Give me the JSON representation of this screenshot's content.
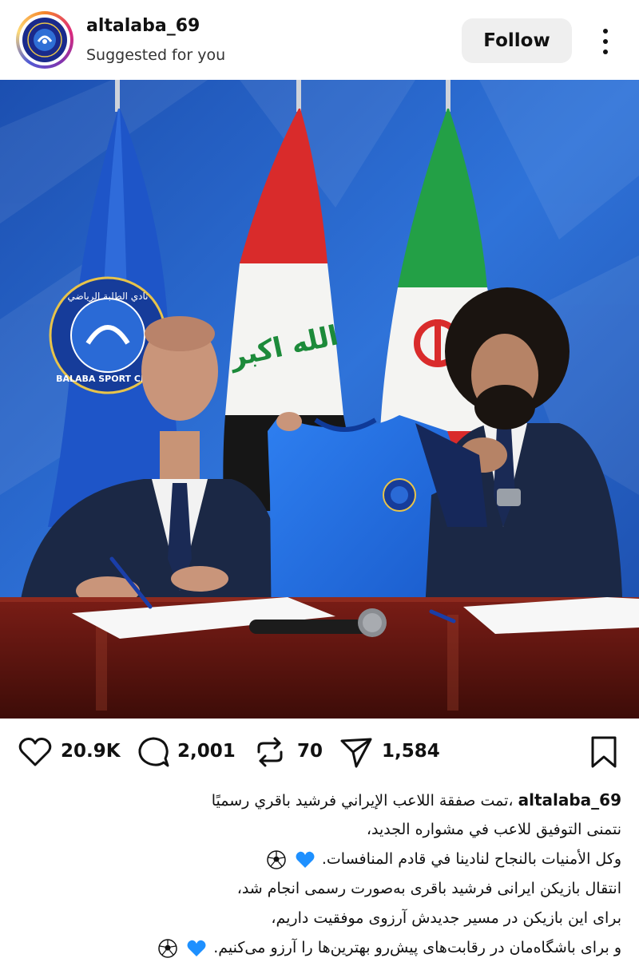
{
  "post": {
    "username": "altalaba_69",
    "subtitle": "Suggested for you",
    "follow_label": "Follow"
  },
  "actions": {
    "likes": "20.9K",
    "comments": "2,001",
    "reposts": "70",
    "shares": "1,584"
  },
  "caption": {
    "username": "altalaba_69",
    "lines": [
      "،تمت صفقة اللاعب الإيراني فرشيد باقري رسميًا",
      "نتمنى التوفيق للاعب في مشواره الجديد،",
      "وكل الأمنيات بالنجاح لنادينا في قادم المنافسات.",
      "انتقال بازیکن ایرانی فرشید باقری به‌صورت رسمی انجام شد،",
      "برای این بازیکن در مسیر جدیدش آرزوی موفقیت داریم،",
      "و برای باشگاه‌مان در رقابت‌های پیش‌رو بهترین‌ها را آرزو می‌کنیم."
    ]
  },
  "photo": {
    "club_flag_text": "BALABA SPORT CLUB",
    "club_flag_arabic": "نادي الطلبة الرياضي",
    "iraq_flag_text": "الله اكبر"
  },
  "colors": {
    "accent_blue": "#1d6fe0",
    "backdrop_blue": "#1e5fc4",
    "heart_blue": "#1e90ff"
  },
  "icons": [
    "heart-icon",
    "comment-icon",
    "repost-icon",
    "share-icon",
    "bookmark-icon",
    "more-icon",
    "soccer-ball-icon",
    "blue-heart-icon"
  ]
}
